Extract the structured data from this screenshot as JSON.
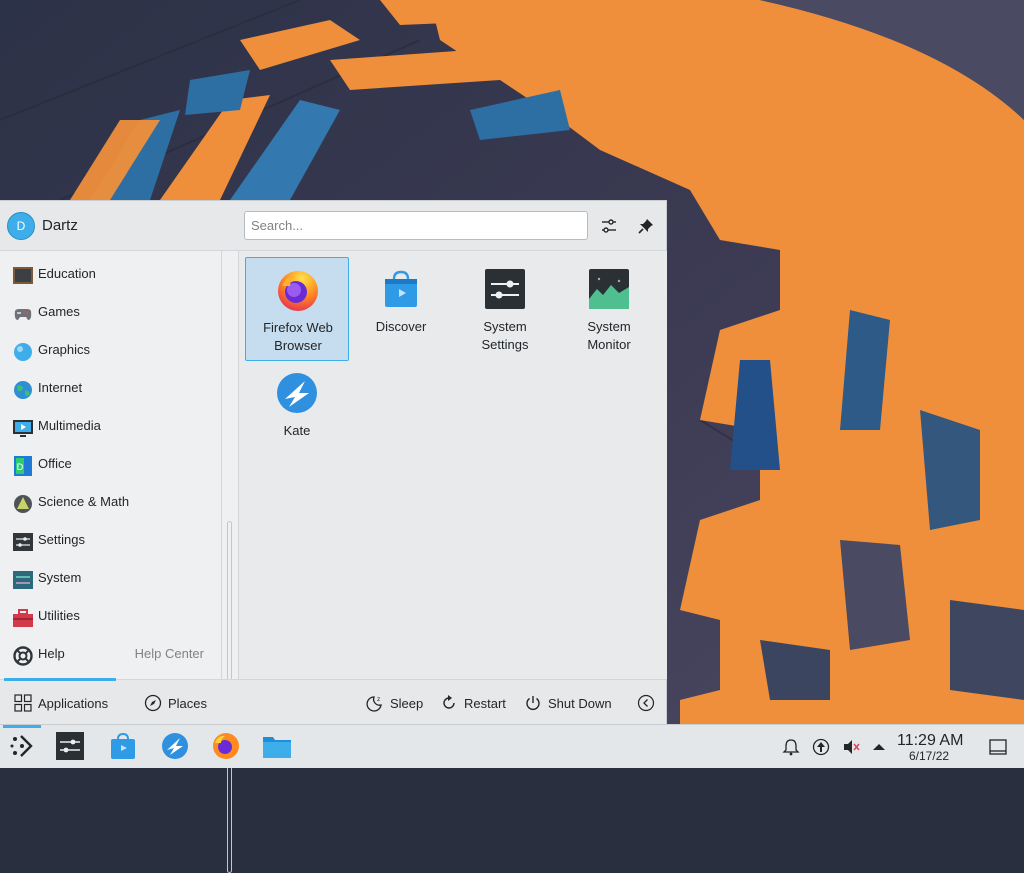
{
  "user": {
    "initial": "D",
    "name": "Dartz"
  },
  "search": {
    "placeholder": "Search..."
  },
  "categories": [
    {
      "label": "Education",
      "icon": "education-icon"
    },
    {
      "label": "Games",
      "icon": "gamepad-icon"
    },
    {
      "label": "Graphics",
      "icon": "graphics-icon"
    },
    {
      "label": "Internet",
      "icon": "globe-icon"
    },
    {
      "label": "Multimedia",
      "icon": "multimedia-icon"
    },
    {
      "label": "Office",
      "icon": "office-icon"
    },
    {
      "label": "Science & Math",
      "icon": "science-icon"
    },
    {
      "label": "Settings",
      "icon": "settings-icon"
    },
    {
      "label": "System",
      "icon": "system-icon"
    },
    {
      "label": "Utilities",
      "icon": "toolbox-icon"
    },
    {
      "label": "Help",
      "icon": "lifebuoy-icon",
      "sub": "Help Center"
    }
  ],
  "apps": [
    {
      "line1": "Firefox Web",
      "line2": "Browser",
      "icon": "firefox-icon",
      "selected": true
    },
    {
      "line1": "Discover",
      "line2": "",
      "icon": "discover-icon"
    },
    {
      "line1": "System",
      "line2": "Settings",
      "icon": "system-settings-icon"
    },
    {
      "line1": "System",
      "line2": "Monitor",
      "icon": "system-monitor-icon"
    },
    {
      "line1": "Kate",
      "line2": "",
      "icon": "kate-icon"
    }
  ],
  "footer": {
    "applications": "Applications",
    "places": "Places",
    "sleep": "Sleep",
    "restart": "Restart",
    "shutdown": "Shut Down"
  },
  "clock": {
    "time": "11:29 AM",
    "date": "6/17/22"
  },
  "colors": {
    "accent": "#3daee9",
    "panel": "#eff0f1",
    "wallpaper_orange": "#ee8e3a"
  }
}
